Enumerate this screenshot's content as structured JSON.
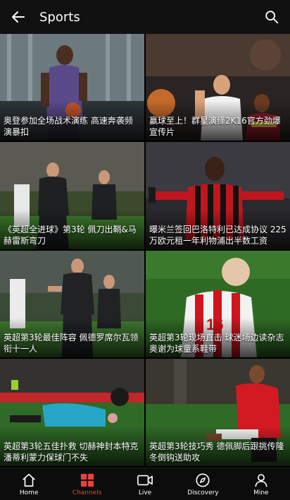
{
  "header": {
    "title": "Sports"
  },
  "tiles": [
    {
      "caption": "奥登参加全场战术演练 高速奔袭频演暴扣"
    },
    {
      "caption": "赢球至上！群星演绎2K16官方劲爆宣传片"
    },
    {
      "caption": "《英超全进球》第3轮 佩刀出鞘&马赫雷斯弯刀"
    },
    {
      "caption": "曝米兰签回巴洛特利已达成协议 225万欧元租一年利物浦出半数工资"
    },
    {
      "caption": "英超第3轮最佳阵容 佩德罗席尔瓦领衔十一人"
    },
    {
      "caption": "英超第3轮现场直击 球迷场边读杂志 奥谢为球童系鞋带"
    },
    {
      "caption": "英超第3轮五佳扑救 切赫神封本特克潘蒂利蒙力保球门不失"
    },
    {
      "caption": "英超第3轮技巧秀 德佩脚后跟挑传隆冬倒钩送助攻"
    }
  ],
  "nav": {
    "items": [
      {
        "label": "Home",
        "icon": "home-icon"
      },
      {
        "label": "Channels",
        "icon": "channels-icon"
      },
      {
        "label": "Live",
        "icon": "live-icon"
      },
      {
        "label": "Discovery",
        "icon": "compass-icon"
      },
      {
        "label": "Mine",
        "icon": "person-icon"
      }
    ],
    "active": "Channels",
    "active_color": "#e8413e"
  }
}
